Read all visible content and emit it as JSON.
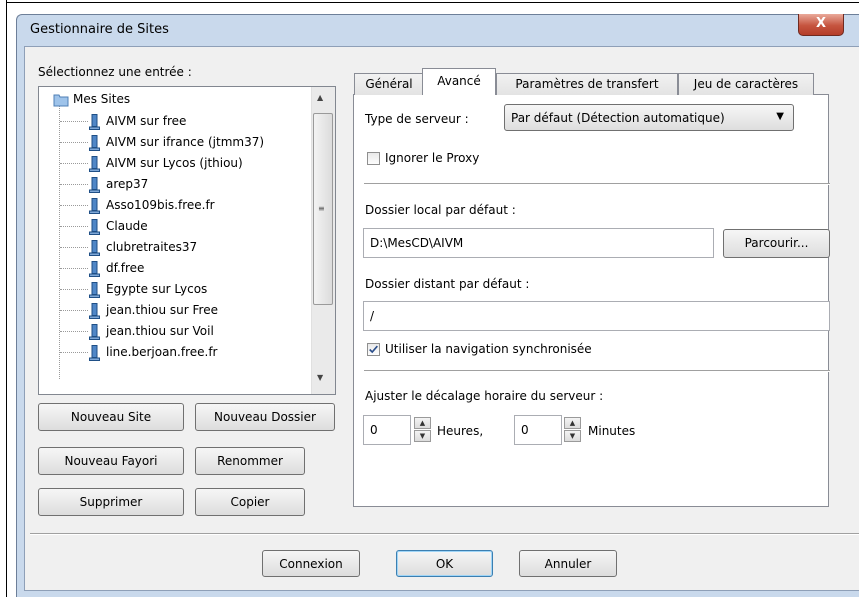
{
  "window": {
    "title": "Gestionnaire de Sites",
    "close_glyph": "X"
  },
  "left": {
    "select_label": "Sélectionnez une entrée :",
    "tree": {
      "root": "Mes Sites",
      "items": [
        "AIVM sur free",
        "AIVM sur ifrance (jtmm37)",
        "AIVM sur Lycos (jthiou)",
        "arep37",
        "Asso109bis.free.fr",
        "Claude",
        "clubretraites37",
        "df.free",
        "Egypte sur Lycos",
        "jean.thiou sur Free",
        "jean.thiou sur Voil",
        "line.berjoan.free.fr"
      ]
    },
    "buttons": {
      "new_site": "Nouveau Site",
      "new_folder": "Nouveau Dossier",
      "new_favorite": "Nouveau Fayori",
      "rename": "Renommer",
      "delete": "Supprimer",
      "copy": "Copier"
    }
  },
  "tabs": [
    "Général",
    "Avancé",
    "Paramètres de transfert",
    "Jeu de caractères"
  ],
  "advanced": {
    "server_type_label": "Type de serveur :",
    "server_type_value": "Par défaut (Détection automatique)",
    "ignore_proxy_label": "Ignorer le Proxy",
    "ignore_proxy_checked": false,
    "local_dir_label": "Dossier local par défaut :",
    "local_dir_value": "D:\\MesCD\\AIVM",
    "browse_button": "Parcourir...",
    "remote_dir_label": "Dossier distant par défaut :",
    "remote_dir_value": "/",
    "sync_nav_label": "Utiliser la navigation synchronisée",
    "sync_nav_checked": true,
    "timezone_label": "Ajuster le décalage horaire du serveur :",
    "hours_value": "0",
    "hours_label": "Heures,",
    "minutes_value": "0",
    "minutes_label": "Minutes"
  },
  "footer": {
    "connect": "Connexion",
    "ok": "OK",
    "cancel": "Annuler"
  }
}
